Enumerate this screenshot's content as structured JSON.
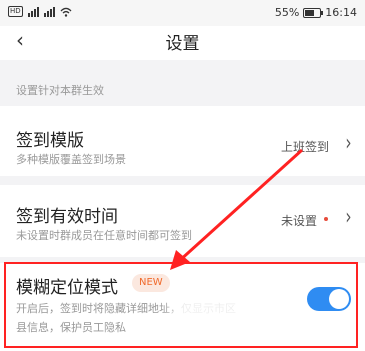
{
  "status_bar": {
    "signal_tag": "HD",
    "battery_percent": "55%",
    "time": "16:14"
  },
  "nav": {
    "back_icon": "chevron-left-icon",
    "title": "设置"
  },
  "section_hint": "设置针对本群生效",
  "rows": [
    {
      "title": "签到模版",
      "subtitle": "多种模版覆盖签到场景",
      "value": "上班签到"
    },
    {
      "title": "签到有效时间",
      "subtitle": "未设置时群成员在任意时间都可签到",
      "value": "未设置"
    },
    {
      "title": "模糊定位模式",
      "badge": "NEW",
      "subtitle": "开启后，签到时将隐藏详细地址，仅显示市区县信息，保护员工隐私",
      "toggle_on": true
    }
  ],
  "colors": {
    "accent": "#2f8cf2",
    "highlight": "#ff2222",
    "badge_text": "#f06a2c",
    "dot": "#e74c3c"
  }
}
